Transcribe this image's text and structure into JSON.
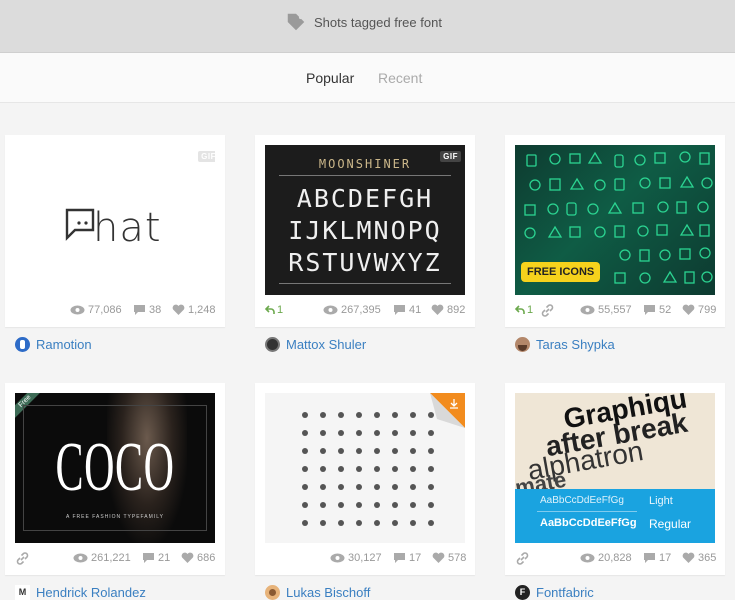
{
  "header": {
    "title": "Shots tagged free font",
    "icon": "tag-icon"
  },
  "tabs": [
    {
      "label": "Popular",
      "active": true
    },
    {
      "label": "Recent",
      "active": false
    }
  ],
  "shots": [
    {
      "author": "Ramotion",
      "views": "77,086",
      "comments": "38",
      "likes": "1,248",
      "badge": "GIF",
      "logo_text": "hat",
      "rebounds": ""
    },
    {
      "author": "Mattox Shuler",
      "views": "267,395",
      "comments": "41",
      "likes": "892",
      "badge": "GIF",
      "rebounds": "1",
      "art": {
        "title": "MOONSHINER",
        "lines": [
          "ABCDEFGH",
          "IJKLMNOPQ",
          "RSTUVWXYZ"
        ]
      }
    },
    {
      "author": "Taras Shypka",
      "views": "55,557",
      "comments": "52",
      "likes": "799",
      "rebounds": "1",
      "art": {
        "label": "FREE ICONS"
      }
    },
    {
      "author": "Hendrick Rolandez",
      "views": "261,221",
      "comments": "21",
      "likes": "686",
      "rebounds": "",
      "art": {
        "ribbon": "Free",
        "word": "COCO",
        "caption": "A FREE FASHION TYPEFAMILY"
      }
    },
    {
      "author": "Lukas Bischoff",
      "views": "30,127",
      "comments": "17",
      "likes": "578",
      "rebounds": ""
    },
    {
      "author": "Fontfabric",
      "views": "20,828",
      "comments": "17",
      "likes": "365",
      "rebounds": "",
      "art": {
        "words": [
          "Graphiqu",
          "after break",
          "alphatron",
          "mate"
        ],
        "sample": "AaBbCcDdEeFfGg",
        "light": "Light",
        "regular": "Regular"
      }
    }
  ],
  "colors": {
    "link": "#3a7fc1",
    "rebound": "#6ca94d",
    "stat": "#999999",
    "free_icons_badge": "#f6d21c",
    "fontfabric_blue": "#1aa3e0"
  }
}
